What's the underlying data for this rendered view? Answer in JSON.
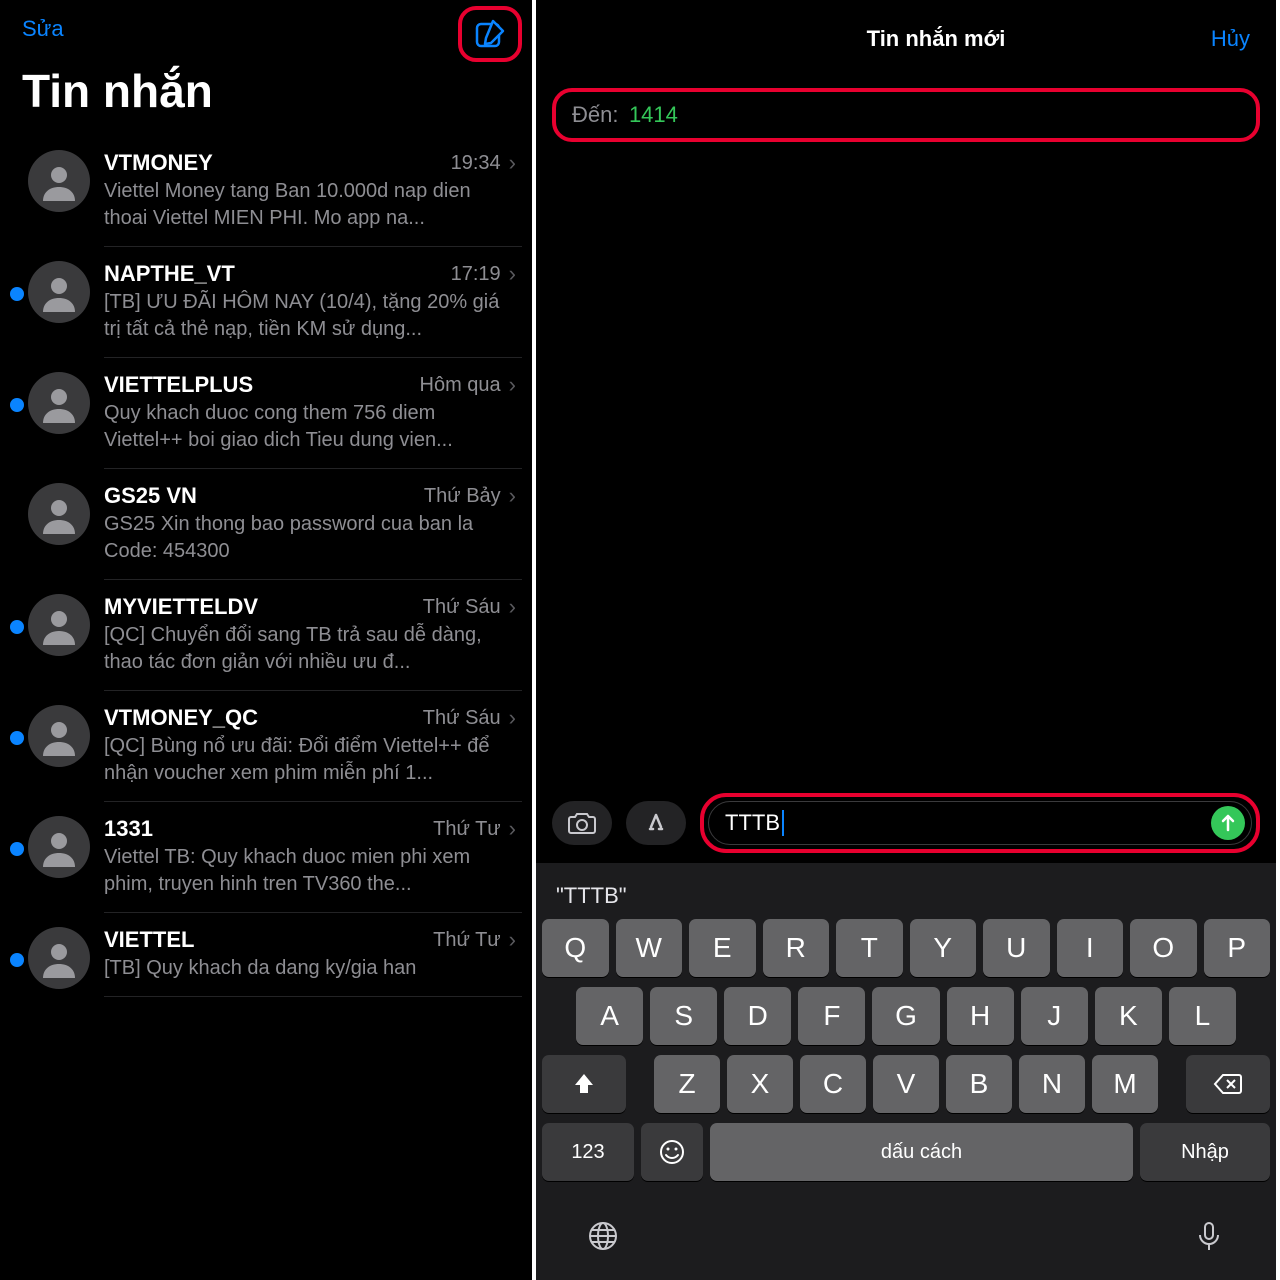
{
  "left": {
    "edit": "Sửa",
    "title": "Tin nhắn",
    "conversations": [
      {
        "sender": "VTMONEY",
        "time": "19:34",
        "preview": "Viettel Money tang Ban 10.000d nap dien thoai Viettel MIEN PHI. Mo app na...",
        "unread": false
      },
      {
        "sender": "NAPTHE_VT",
        "time": "17:19",
        "preview": "[TB] ƯU ĐÃI HÔM NAY (10/4), tặng 20% giá trị tất cả thẻ nạp, tiền KM sử dụng...",
        "unread": true
      },
      {
        "sender": "VIETTELPLUS",
        "time": "Hôm qua",
        "preview": "Quy khach duoc cong them 756 diem Viettel++ boi giao dich Tieu dung vien...",
        "unread": true
      },
      {
        "sender": "GS25 VN",
        "time": "Thứ Bảy",
        "preview": "GS25 Xin thong bao password cua ban la Code: 454300",
        "unread": false
      },
      {
        "sender": "MYVIETTELDV",
        "time": "Thứ Sáu",
        "preview": "[QC] Chuyển đổi sang TB trả sau dễ dàng, thao tác đơn giản với nhiều ưu đ...",
        "unread": true
      },
      {
        "sender": "VTMONEY_QC",
        "time": "Thứ Sáu",
        "preview": "[QC] Bùng nổ ưu đãi: Đổi điểm Viettel++ để nhận voucher xem phim miễn phí 1...",
        "unread": true
      },
      {
        "sender": "1331",
        "time": "Thứ Tư",
        "preview": "Viettel TB: Quy khach duoc mien phi xem phim, truyen hinh tren TV360 the...",
        "unread": true
      },
      {
        "sender": "VIETTEL",
        "time": "Thứ Tư",
        "preview": "[TB] Quy khach da dang ky/gia han",
        "unread": true
      }
    ]
  },
  "right": {
    "title": "Tin nhắn mới",
    "cancel": "Hủy",
    "to_label": "Đến:",
    "to_value": "1414",
    "input_text": "TTTB",
    "suggestion": "\"TTTB\"",
    "keyboard": {
      "row1": [
        "Q",
        "W",
        "E",
        "R",
        "T",
        "Y",
        "U",
        "I",
        "O",
        "P"
      ],
      "row2": [
        "A",
        "S",
        "D",
        "F",
        "G",
        "H",
        "J",
        "K",
        "L"
      ],
      "row3": [
        "Z",
        "X",
        "C",
        "V",
        "B",
        "N",
        "M"
      ],
      "num": "123",
      "space": "dấu cách",
      "return": "Nhập"
    }
  }
}
